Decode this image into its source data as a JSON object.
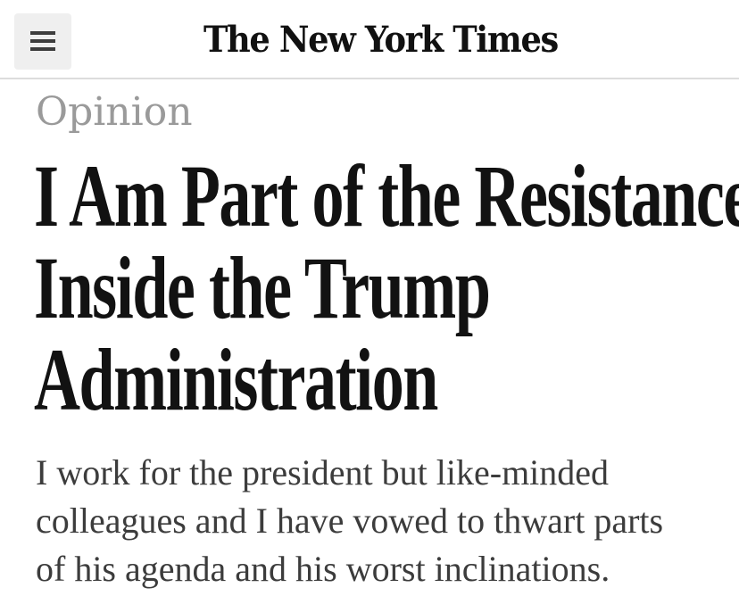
{
  "header": {
    "masthead": "The New York Times",
    "menu_icon": "hamburger-menu-icon"
  },
  "article": {
    "section": "Opinion",
    "headline_lines": [
      "I Am Part of the Resistance",
      "Inside the Trump",
      "Administration"
    ],
    "summary_lines": [
      "I work for the president but like-minded",
      "colleagues and I have vowed to thwart parts",
      "of his agenda and his worst inclinations."
    ]
  },
  "colors": {
    "background": "#ffffff",
    "menu_button_bg": "#efefef",
    "section_label": "#9a9a9a",
    "headline": "#121212",
    "summary": "#3c3c3c",
    "divider": "#dcdcdc"
  }
}
